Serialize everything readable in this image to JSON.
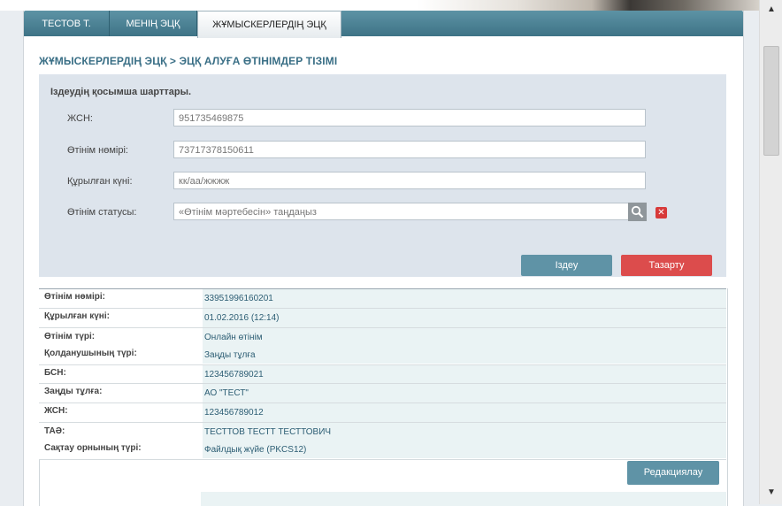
{
  "tabs": [
    {
      "label": "ТЕСТОВ Т."
    },
    {
      "label": "МЕНІҢ ЭЦҚ"
    },
    {
      "label": "ЖҰМЫСКЕРЛЕРДІҢ ЭЦҚ"
    }
  ],
  "breadcrumb": "ЖҰМЫСКЕРЛЕРДІҢ ЭЦҚ > ЭЦҚ АЛУҒА ӨТІНІМДЕР ТІЗІМІ",
  "search": {
    "title": "Іздеудің қосымша шарттары.",
    "fields": [
      {
        "label": "ЖСН:",
        "value": "951735469875"
      },
      {
        "label": "Өтінім нөмірі:",
        "value": "73717378150611"
      },
      {
        "label": "Құрылған күні:",
        "value": "кк/аа/жжжж"
      },
      {
        "label": "Өтінім статусы:",
        "value": "«Өтінім мәртебесін» таңдаңыз"
      }
    ],
    "search_button": "Іздеу",
    "clear_button": "Тазарту"
  },
  "result": {
    "rows": [
      {
        "key": "Өтінім нөмірі:",
        "value": "33951996160201"
      },
      {
        "key": "Құрылған күні:",
        "value": "01.02.2016 (12:14)"
      },
      {
        "key": "Өтінім түрі:",
        "value": "Онлайн өтінім"
      },
      {
        "key": "Қолданушының түрі:",
        "value": "Заңды тұлға"
      },
      {
        "key": "БСН:",
        "value": "123456789021"
      },
      {
        "key": "Заңды тұлға:",
        "value": "АО \"ТЕСТ\""
      },
      {
        "key": "ЖСН:",
        "value": "123456789012"
      },
      {
        "key": "ТАӘ:",
        "value": "ТЕСТТОВ ТЕСТТ ТЕСТТОВИЧ"
      },
      {
        "key": "Сақтау орнының түрі:",
        "value": "Файлдық жүйе (PKCS12)"
      }
    ],
    "edit_button": "Редакциялау"
  },
  "icons": {
    "search": "magnifier-icon",
    "clear": "close-icon",
    "scroll_up": "arrow-up-icon",
    "scroll_down": "arrow-down-icon"
  }
}
